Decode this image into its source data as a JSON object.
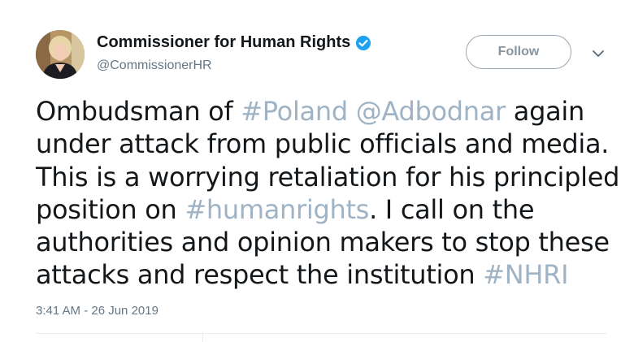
{
  "author": {
    "display_name": "Commissioner for Human Rights",
    "handle": "@CommissionerHR",
    "verified": true,
    "avatar_icon": "profile-photo"
  },
  "actions": {
    "follow_label": "Follow",
    "more_icon": "chevron-down-icon"
  },
  "tweet": {
    "lines": [
      [
        {
          "t": "Ombudsman of ",
          "tag": false
        },
        {
          "t": "#Poland",
          "tag": true
        },
        {
          "t": " ",
          "tag": false
        },
        {
          "t": "@Adbodnar",
          "tag": true
        },
        {
          "t": " again",
          "tag": false
        }
      ],
      [
        {
          "t": "under attack from public officials and media.",
          "tag": false
        }
      ],
      [
        {
          "t": "This is a worrying retaliation for his principled",
          "tag": false
        }
      ],
      [
        {
          "t": "position on ",
          "tag": false
        },
        {
          "t": "#humanrights",
          "tag": true
        },
        {
          "t": ". I call on the",
          "tag": false
        }
      ],
      [
        {
          "t": "authorities and opinion makers to stop these",
          "tag": false
        }
      ],
      [
        {
          "t": "attacks and respect the institution ",
          "tag": false
        },
        {
          "t": "#NHRI",
          "tag": true
        }
      ]
    ],
    "timestamp": "3:41 AM - 26 Jun 2019"
  },
  "colors": {
    "link": "#9fb3c4",
    "verified_badge": "#1da1f2",
    "muted_text": "#657786"
  }
}
